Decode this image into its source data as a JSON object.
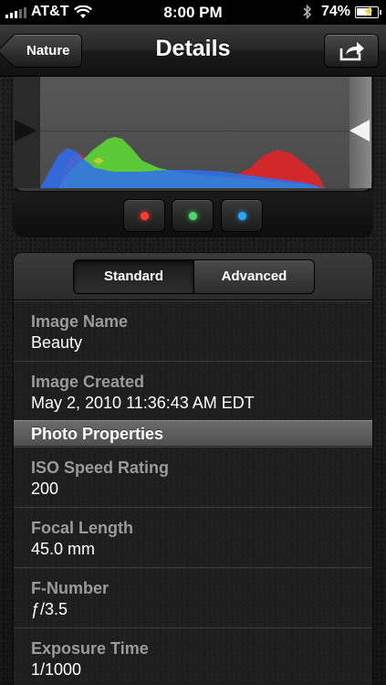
{
  "status_bar": {
    "carrier": "AT&T",
    "time": "8:00 PM",
    "battery_percent": "74%",
    "battery_level": 0.74
  },
  "nav": {
    "back_label": "Nature",
    "title": "Details",
    "share_icon": "share-icon"
  },
  "histogram": {
    "channels": [
      {
        "name": "red",
        "color": "#e8342a"
      },
      {
        "name": "green",
        "color": "#5ed23a"
      },
      {
        "name": "blue",
        "color": "#2f8fe8"
      }
    ]
  },
  "segmented": {
    "standard_label": "Standard",
    "advanced_label": "Advanced",
    "selected": "Standard"
  },
  "details": {
    "image_name": {
      "label": "Image Name",
      "value": "Beauty"
    },
    "image_created": {
      "label": "Image Created",
      "value": "May 2, 2010 11:36:43 AM EDT"
    },
    "photo_properties_title": "Photo Properties",
    "iso": {
      "label": "ISO Speed Rating",
      "value": "200"
    },
    "focal_length": {
      "label": "Focal Length",
      "value": "45.0 mm"
    },
    "f_number": {
      "label": "F-Number",
      "value": "ƒ/3.5"
    },
    "exposure_time": {
      "label": "Exposure Time",
      "value": "1/1000"
    }
  }
}
